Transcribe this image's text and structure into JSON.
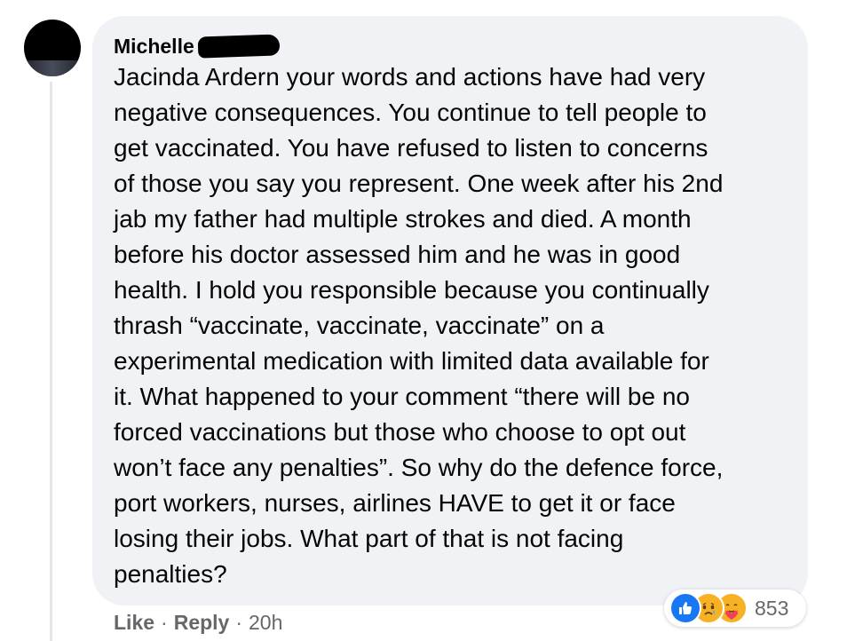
{
  "comment": {
    "author": "Michelle",
    "text": "Jacinda Ardern your words and actions have had very\nnegative consequences. You continue to tell people to\nget vaccinated. You have refused to listen to concerns\nof those you say you represent. One week after his 2nd\njab my father had multiple strokes and died. A month\nbefore his doctor assessed him and he was in good\nhealth. I hold you responsible because you continually\nthrash “vaccinate, vaccinate, vaccinate” on a\nexperimental medication with limited data available for\nit. What happened to your comment “there will be no\nforced vaccinations but those who choose to opt out\nwon’t face any penalties”. So why do the defence force,\nport workers, nurses, airlines HAVE to get it or face\nlosing their jobs. What part of that is not facing\npenalties?"
  },
  "actions": {
    "like_label": "Like",
    "reply_label": "Reply",
    "separator": "·",
    "time": "20h"
  },
  "reactions": {
    "icons": [
      "like-icon",
      "sad-icon",
      "care-icon"
    ],
    "count": "853"
  },
  "colors": {
    "bubble": "#f0f2f5",
    "like_blue": "#1877f2",
    "emoji_yellow": "#f7b125",
    "meta_gray": "#65676b"
  }
}
